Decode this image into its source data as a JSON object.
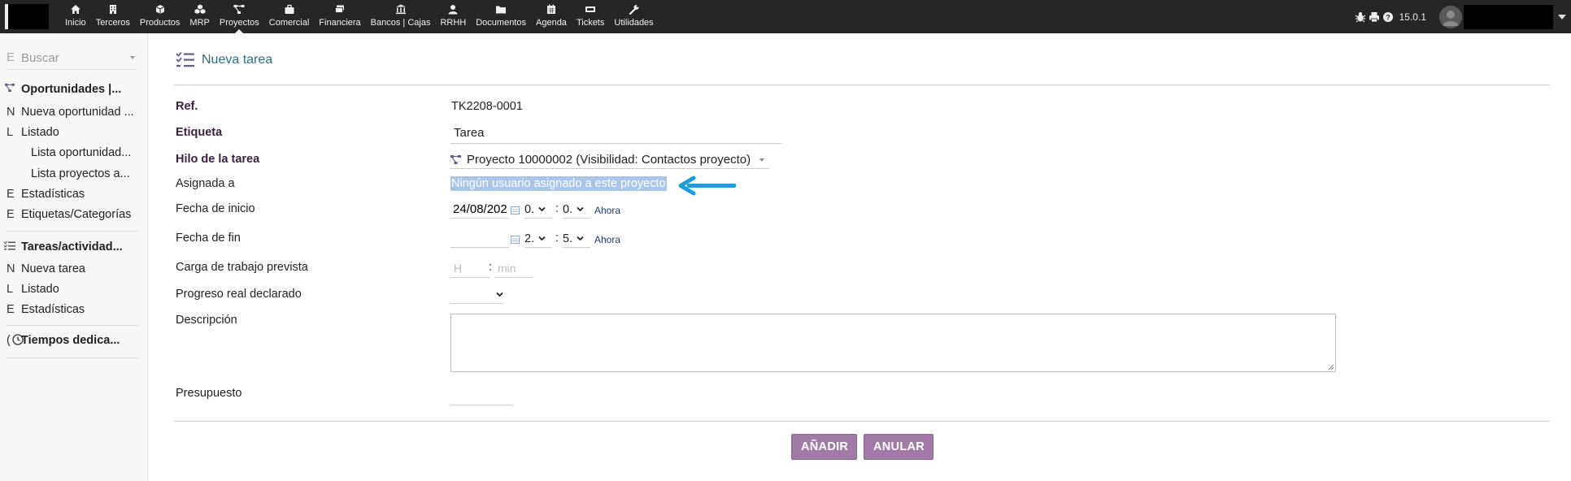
{
  "topbar": {
    "menu": [
      {
        "label": "Inicio",
        "icon": "home-icon"
      },
      {
        "label": "Terceros",
        "icon": "building-icon"
      },
      {
        "label": "Productos",
        "icon": "cube-icon"
      },
      {
        "label": "MRP",
        "icon": "cubes-icon"
      },
      {
        "label": "Proyectos",
        "icon": "project-diagram-icon",
        "active": true
      },
      {
        "label": "Comercial",
        "icon": "suitcase-icon"
      },
      {
        "label": "Financiera",
        "icon": "money-icon"
      },
      {
        "label": "Bancos | Cajas",
        "icon": "bank-icon"
      },
      {
        "label": "RRHH",
        "icon": "user-icon"
      },
      {
        "label": "Documentos",
        "icon": "folder-icon"
      },
      {
        "label": "Agenda",
        "icon": "calendar-icon"
      },
      {
        "label": "Tickets",
        "icon": "ticket-icon"
      },
      {
        "label": "Utilidades",
        "icon": "wrench-icon"
      }
    ],
    "version": "15.0.1"
  },
  "sidebar": {
    "search_prefix": "E",
    "search_placeholder": "Buscar",
    "items": [
      {
        "lead": "N",
        "label": "Nueva oportunidad ..."
      },
      {
        "lead": "L",
        "label": "Listado"
      },
      {
        "label": "Lista oportunidad..."
      },
      {
        "label": "Lista proyectos a..."
      },
      {
        "lead": "E",
        "label": "Estadísticas"
      },
      {
        "lead": "E",
        "label": "Etiquetas/Categorías"
      },
      {
        "lead": "N",
        "label": "Nueva tarea"
      },
      {
        "lead": "L",
        "label": "Listado"
      },
      {
        "lead": "E",
        "label": "Estadísticas"
      }
    ],
    "heads": [
      {
        "lead": "",
        "label": "Oportunidades |..."
      },
      {
        "lead": "",
        "label": "Tareas/actividad..."
      },
      {
        "lead": "(",
        "label": "Tiempos dedica..."
      }
    ]
  },
  "form": {
    "title": "Nueva tarea",
    "ref_label": "Ref.",
    "ref_value": "TK2208-0001",
    "etiqueta_label": "Etiqueta",
    "etiqueta_value": "Tarea",
    "hilo_label": "Hilo de la tarea",
    "hilo_value": "Proyecto 10000002 (Visibilidad: Contactos proyecto)",
    "asignada_label": "Asignada a",
    "asignada_value": "Ningún usuario asignado a este proyecto",
    "inicio_label": "Fecha de inicio",
    "inicio_date": "24/08/202",
    "inicio_hour": "0.",
    "inicio_min": "0.",
    "fin_label": "Fecha de fin",
    "fin_date": "",
    "fin_hour": "2.",
    "fin_min": "5.",
    "ahora": "Ahora",
    "carga_label": "Carga de trabajo prevista",
    "carga_h_placeholder": "H",
    "carga_min_placeholder": "min",
    "progreso_label": "Progreso real declarado",
    "descripcion_label": "Descripción",
    "presupuesto_label": "Presupuesto"
  },
  "buttons": {
    "add": "AÑADIR",
    "cancel": "ANULAR"
  },
  "colors": {
    "topbar": "#262626",
    "accent_button": "#a27aa8",
    "title_blue": "#2d6e8a",
    "required_label": "#3b2141",
    "arrow_blue": "#1f9be0",
    "highlight": "#a9c6ea"
  }
}
